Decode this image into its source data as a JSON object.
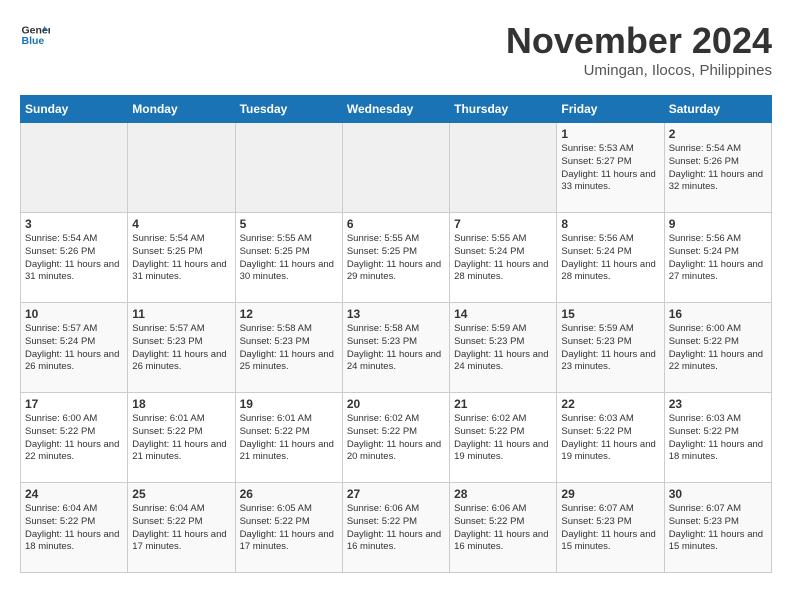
{
  "header": {
    "logo_line1": "General",
    "logo_line2": "Blue",
    "month_year": "November 2024",
    "location": "Umingan, Ilocos, Philippines"
  },
  "weekdays": [
    "Sunday",
    "Monday",
    "Tuesday",
    "Wednesday",
    "Thursday",
    "Friday",
    "Saturday"
  ],
  "weeks": [
    [
      {
        "day": "",
        "sunrise": "",
        "sunset": "",
        "daylight": ""
      },
      {
        "day": "",
        "sunrise": "",
        "sunset": "",
        "daylight": ""
      },
      {
        "day": "",
        "sunrise": "",
        "sunset": "",
        "daylight": ""
      },
      {
        "day": "",
        "sunrise": "",
        "sunset": "",
        "daylight": ""
      },
      {
        "day": "",
        "sunrise": "",
        "sunset": "",
        "daylight": ""
      },
      {
        "day": "1",
        "sunrise": "Sunrise: 5:53 AM",
        "sunset": "Sunset: 5:27 PM",
        "daylight": "Daylight: 11 hours and 33 minutes."
      },
      {
        "day": "2",
        "sunrise": "Sunrise: 5:54 AM",
        "sunset": "Sunset: 5:26 PM",
        "daylight": "Daylight: 11 hours and 32 minutes."
      }
    ],
    [
      {
        "day": "3",
        "sunrise": "Sunrise: 5:54 AM",
        "sunset": "Sunset: 5:26 PM",
        "daylight": "Daylight: 11 hours and 31 minutes."
      },
      {
        "day": "4",
        "sunrise": "Sunrise: 5:54 AM",
        "sunset": "Sunset: 5:25 PM",
        "daylight": "Daylight: 11 hours and 31 minutes."
      },
      {
        "day": "5",
        "sunrise": "Sunrise: 5:55 AM",
        "sunset": "Sunset: 5:25 PM",
        "daylight": "Daylight: 11 hours and 30 minutes."
      },
      {
        "day": "6",
        "sunrise": "Sunrise: 5:55 AM",
        "sunset": "Sunset: 5:25 PM",
        "daylight": "Daylight: 11 hours and 29 minutes."
      },
      {
        "day": "7",
        "sunrise": "Sunrise: 5:55 AM",
        "sunset": "Sunset: 5:24 PM",
        "daylight": "Daylight: 11 hours and 28 minutes."
      },
      {
        "day": "8",
        "sunrise": "Sunrise: 5:56 AM",
        "sunset": "Sunset: 5:24 PM",
        "daylight": "Daylight: 11 hours and 28 minutes."
      },
      {
        "day": "9",
        "sunrise": "Sunrise: 5:56 AM",
        "sunset": "Sunset: 5:24 PM",
        "daylight": "Daylight: 11 hours and 27 minutes."
      }
    ],
    [
      {
        "day": "10",
        "sunrise": "Sunrise: 5:57 AM",
        "sunset": "Sunset: 5:24 PM",
        "daylight": "Daylight: 11 hours and 26 minutes."
      },
      {
        "day": "11",
        "sunrise": "Sunrise: 5:57 AM",
        "sunset": "Sunset: 5:23 PM",
        "daylight": "Daylight: 11 hours and 26 minutes."
      },
      {
        "day": "12",
        "sunrise": "Sunrise: 5:58 AM",
        "sunset": "Sunset: 5:23 PM",
        "daylight": "Daylight: 11 hours and 25 minutes."
      },
      {
        "day": "13",
        "sunrise": "Sunrise: 5:58 AM",
        "sunset": "Sunset: 5:23 PM",
        "daylight": "Daylight: 11 hours and 24 minutes."
      },
      {
        "day": "14",
        "sunrise": "Sunrise: 5:59 AM",
        "sunset": "Sunset: 5:23 PM",
        "daylight": "Daylight: 11 hours and 24 minutes."
      },
      {
        "day": "15",
        "sunrise": "Sunrise: 5:59 AM",
        "sunset": "Sunset: 5:23 PM",
        "daylight": "Daylight: 11 hours and 23 minutes."
      },
      {
        "day": "16",
        "sunrise": "Sunrise: 6:00 AM",
        "sunset": "Sunset: 5:22 PM",
        "daylight": "Daylight: 11 hours and 22 minutes."
      }
    ],
    [
      {
        "day": "17",
        "sunrise": "Sunrise: 6:00 AM",
        "sunset": "Sunset: 5:22 PM",
        "daylight": "Daylight: 11 hours and 22 minutes."
      },
      {
        "day": "18",
        "sunrise": "Sunrise: 6:01 AM",
        "sunset": "Sunset: 5:22 PM",
        "daylight": "Daylight: 11 hours and 21 minutes."
      },
      {
        "day": "19",
        "sunrise": "Sunrise: 6:01 AM",
        "sunset": "Sunset: 5:22 PM",
        "daylight": "Daylight: 11 hours and 21 minutes."
      },
      {
        "day": "20",
        "sunrise": "Sunrise: 6:02 AM",
        "sunset": "Sunset: 5:22 PM",
        "daylight": "Daylight: 11 hours and 20 minutes."
      },
      {
        "day": "21",
        "sunrise": "Sunrise: 6:02 AM",
        "sunset": "Sunset: 5:22 PM",
        "daylight": "Daylight: 11 hours and 19 minutes."
      },
      {
        "day": "22",
        "sunrise": "Sunrise: 6:03 AM",
        "sunset": "Sunset: 5:22 PM",
        "daylight": "Daylight: 11 hours and 19 minutes."
      },
      {
        "day": "23",
        "sunrise": "Sunrise: 6:03 AM",
        "sunset": "Sunset: 5:22 PM",
        "daylight": "Daylight: 11 hours and 18 minutes."
      }
    ],
    [
      {
        "day": "24",
        "sunrise": "Sunrise: 6:04 AM",
        "sunset": "Sunset: 5:22 PM",
        "daylight": "Daylight: 11 hours and 18 minutes."
      },
      {
        "day": "25",
        "sunrise": "Sunrise: 6:04 AM",
        "sunset": "Sunset: 5:22 PM",
        "daylight": "Daylight: 11 hours and 17 minutes."
      },
      {
        "day": "26",
        "sunrise": "Sunrise: 6:05 AM",
        "sunset": "Sunset: 5:22 PM",
        "daylight": "Daylight: 11 hours and 17 minutes."
      },
      {
        "day": "27",
        "sunrise": "Sunrise: 6:06 AM",
        "sunset": "Sunset: 5:22 PM",
        "daylight": "Daylight: 11 hours and 16 minutes."
      },
      {
        "day": "28",
        "sunrise": "Sunrise: 6:06 AM",
        "sunset": "Sunset: 5:22 PM",
        "daylight": "Daylight: 11 hours and 16 minutes."
      },
      {
        "day": "29",
        "sunrise": "Sunrise: 6:07 AM",
        "sunset": "Sunset: 5:23 PM",
        "daylight": "Daylight: 11 hours and 15 minutes."
      },
      {
        "day": "30",
        "sunrise": "Sunrise: 6:07 AM",
        "sunset": "Sunset: 5:23 PM",
        "daylight": "Daylight: 11 hours and 15 minutes."
      }
    ]
  ]
}
